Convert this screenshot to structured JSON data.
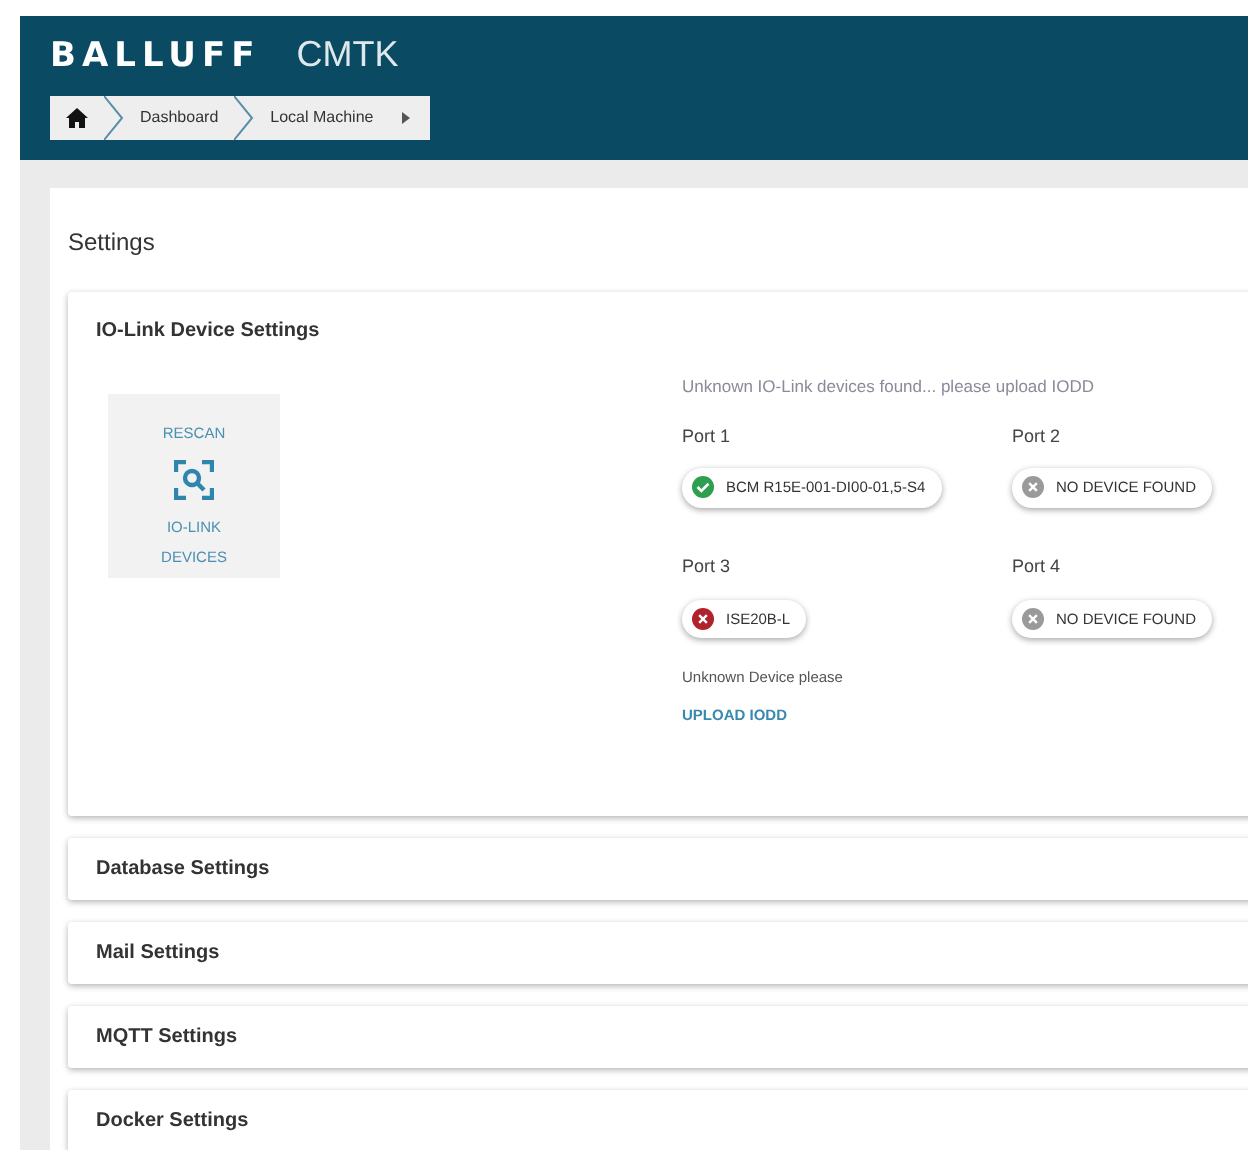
{
  "header": {
    "logo": "BALLUFF",
    "app_title": "CMTK"
  },
  "breadcrumb": [
    {
      "label": "Dashboard"
    },
    {
      "label": "Local Machine"
    }
  ],
  "page_title": "Settings",
  "io_link": {
    "title": "IO-Link Device Settings",
    "rescan": {
      "top": "RESCAN",
      "bottom": [
        "IO-LINK",
        "DEVICES"
      ]
    },
    "message": "Unknown IO-Link devices found... please upload IODD",
    "ports": [
      {
        "label": "Port 1",
        "device": "BCM R15E-001-DI00-01,5-S4",
        "ok": true,
        "color": "#2e9e4f"
      },
      {
        "label": "Port 2",
        "device": "NO DEVICE FOUND",
        "ok": false,
        "color": "#9a9a9a"
      },
      {
        "label": "Port 3",
        "device": "ISE20B-L",
        "ok": false,
        "color": "#b0222c",
        "note": "Unknown Device please",
        "action": "UPLOAD IODD"
      },
      {
        "label": "Port 4",
        "device": "NO DEVICE FOUND",
        "ok": false,
        "color": "#9a9a9a"
      }
    ]
  },
  "sections": [
    {
      "title": "Database Settings"
    },
    {
      "title": "Mail Settings"
    },
    {
      "title": "MQTT Settings"
    },
    {
      "title": "Docker Settings"
    }
  ]
}
